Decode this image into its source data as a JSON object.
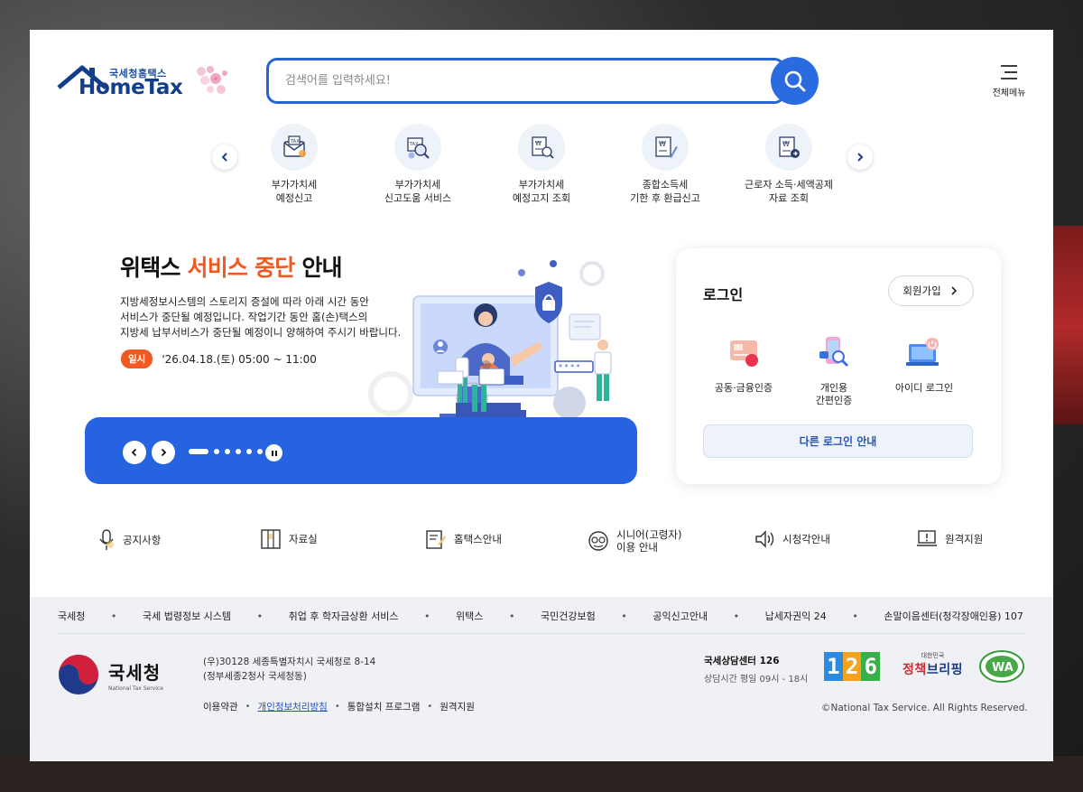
{
  "header": {
    "logo_small": "국세청홈택스",
    "logo_main": "HomeTax",
    "search_placeholder": "검색어를 입력하세요!",
    "menu_label": "전체메뉴"
  },
  "quick_menu": [
    {
      "label": "부가가치세\n예정신고",
      "icon": "tax-envelope-icon"
    },
    {
      "label": "부가가치세\n신고도움 서비스",
      "icon": "tax-search-icon"
    },
    {
      "label": "부가가치세\n예정고지 조회",
      "icon": "won-document-search-icon"
    },
    {
      "label": "종합소득세\n기한 후 환급신고",
      "icon": "won-document-pen-icon"
    },
    {
      "label": "근로자 소득·세액공제\n자료 조회",
      "icon": "won-document-arrow-icon"
    }
  ],
  "banner": {
    "title_pre": "위택스 ",
    "title_accent": "서비스 중단",
    "title_post": " 안내",
    "description": "지방세정보시스템의 스토리지 증설에 따라 아래 시간 동안\n서비스가 중단될 예정입니다. 작업기간 동안 홈(손)택스의\n지방세 납부서비스가 중단될 예정이니 양해하여 주시기 바랍니다.",
    "date_badge": "일시",
    "date_text": "'26.04.18.(토) 05:00 ~ 11:00",
    "accent_color": "#f05a22",
    "bar_color": "#2563e0"
  },
  "login": {
    "title": "로그인",
    "signup_label": "회원가입",
    "options": [
      {
        "label": "공동·금융인증",
        "icon": "certificate-card-icon"
      },
      {
        "label": "개인용\n간편인증",
        "icon": "mobile-search-icon"
      },
      {
        "label": "아이디 로그인",
        "icon": "laptop-power-icon"
      }
    ],
    "other_label": "다른 로그인 안내"
  },
  "quick_links": [
    {
      "label": "공지사항",
      "icon": "microphone-icon"
    },
    {
      "label": "자료실",
      "icon": "cabinet-icon"
    },
    {
      "label": "홈택스안내",
      "icon": "edit-document-icon"
    },
    {
      "label": "시니어(고령자)\n이용 안내",
      "icon": "senior-icon"
    },
    {
      "label": "시청각안내",
      "icon": "speaker-icon"
    },
    {
      "label": "원격지원",
      "icon": "remote-support-icon"
    }
  ],
  "footer": {
    "links": [
      "국세청",
      "국세 법령정보 시스템",
      "취업 후 학자금상환 서비스",
      "위택스",
      "국민건강보험",
      "공익신고안내",
      "납세자권익 24",
      "손말이음센터(청각장애인용) 107"
    ],
    "nts_kr": "국세청",
    "nts_en": "National Tax Service",
    "address": "(우)30128 세종특별자치시 국세청로 8-14\n(정부세종2청사 국세청동)",
    "bottom_links": [
      "이용약관",
      "개인정보처리방침",
      "통합설치 프로그램",
      "원격지원"
    ],
    "center_title": "국세상담센터 126",
    "center_hours": "상담시간 평일 09시 - 18시",
    "badge_digits": [
      "1",
      "2",
      "6"
    ],
    "brief_small": "대한민국",
    "brief_main_1": "정책",
    "brief_main_2": "브리핑",
    "copyright": "©National Tax Service. All Rights Reserved."
  }
}
